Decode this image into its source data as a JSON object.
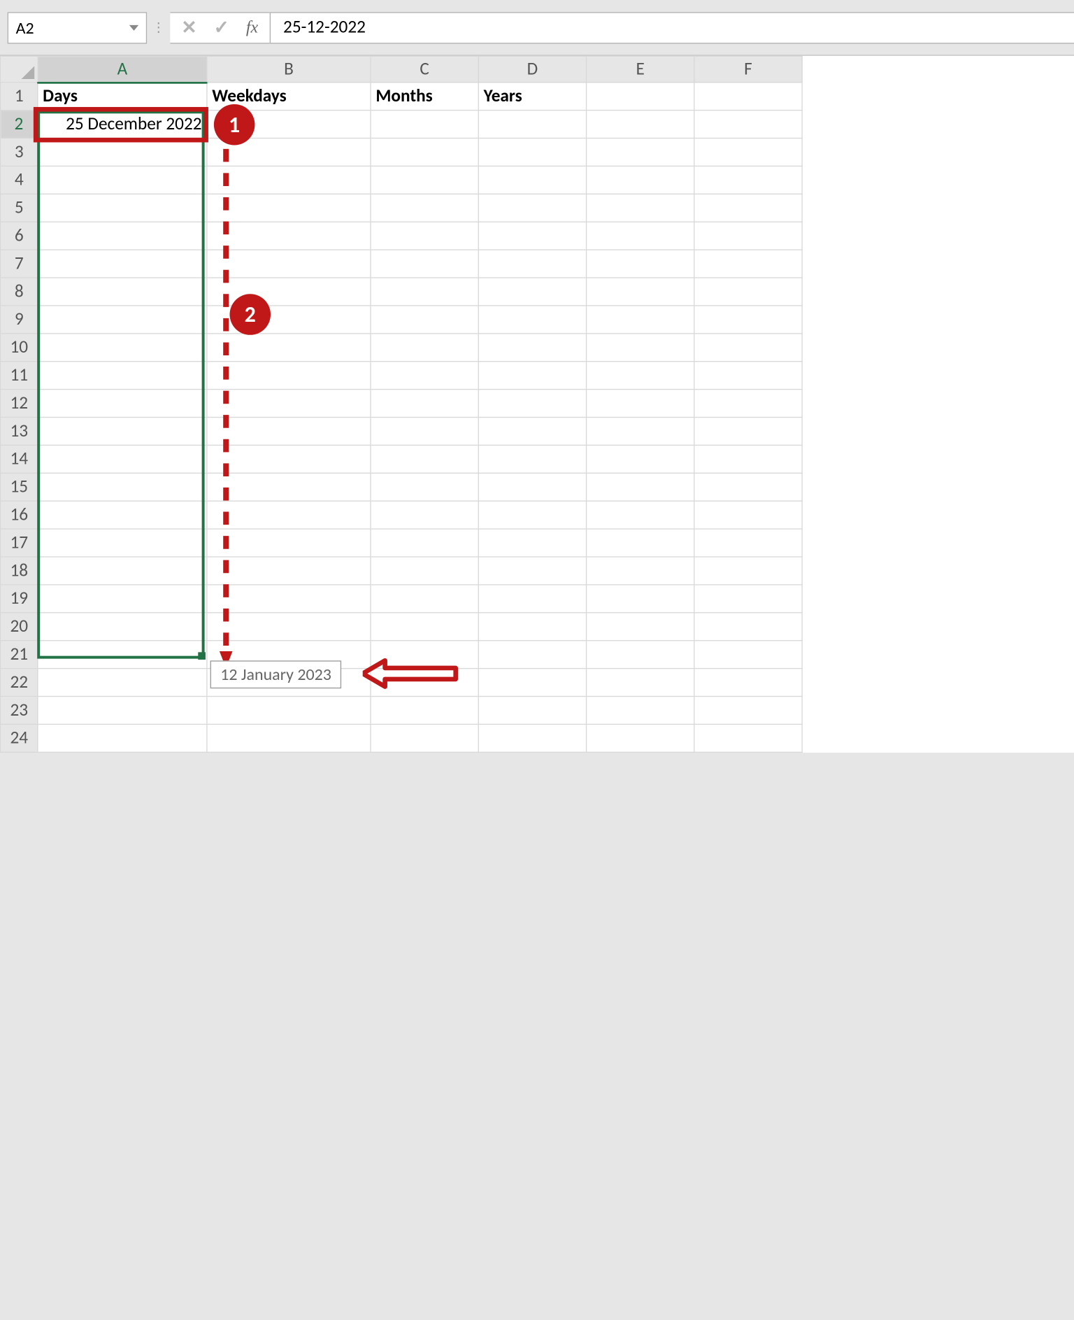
{
  "nameBox": "A2",
  "formulaBar": "25-12-2022",
  "fxLabel": "fx",
  "columns": [
    "A",
    "B",
    "C",
    "D",
    "E",
    "F"
  ],
  "rowNumbers": [
    "1",
    "2",
    "3",
    "4",
    "5",
    "6",
    "7",
    "8",
    "9",
    "10",
    "11",
    "12",
    "13",
    "14",
    "15",
    "16",
    "17",
    "18",
    "19",
    "20",
    "21",
    "22",
    "23",
    "24"
  ],
  "cells": {
    "A1": "Days",
    "B1": "Weekdays",
    "C1": "Months",
    "D1": "Years",
    "A2": "25 December 2022"
  },
  "tooltip": "12 January 2023",
  "callouts": {
    "one": "1",
    "two": "2"
  }
}
